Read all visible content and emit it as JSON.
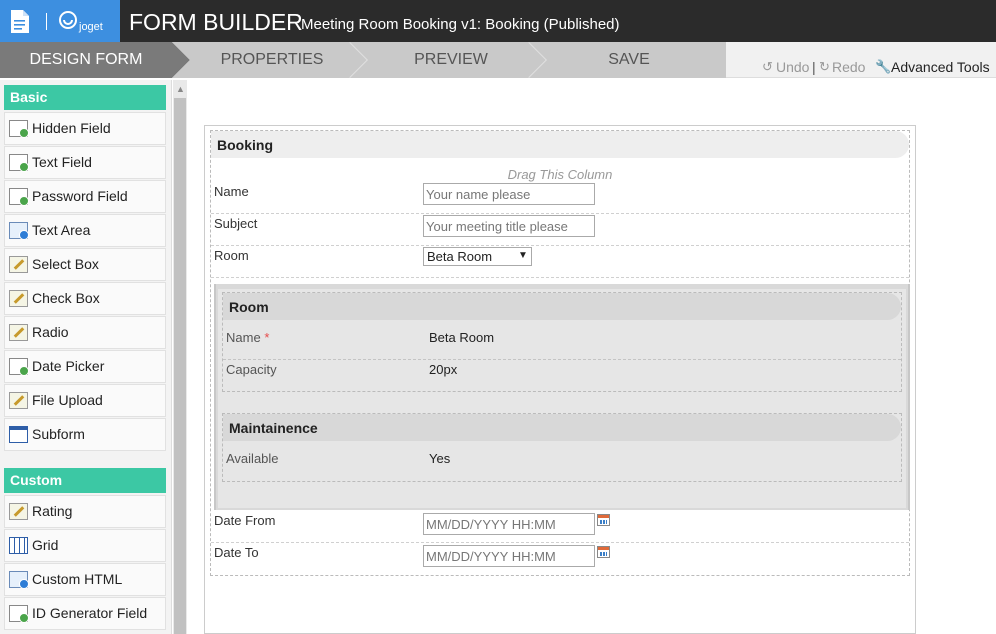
{
  "header": {
    "brand": "joget",
    "title": "FORM BUILDER",
    "subtitle": "Meeting Room Booking v1: Booking (Published)"
  },
  "steps": [
    "DESIGN FORM",
    "PROPERTIES",
    "PREVIEW",
    "SAVE"
  ],
  "active_step": "DESIGN FORM",
  "tools": {
    "undo": "Undo",
    "separator": "|",
    "redo": "Redo",
    "advanced": "Advanced Tools"
  },
  "palette": {
    "basic_title": "Basic",
    "basic": [
      {
        "label": "Hidden Field",
        "icon": "hidden-field-icon"
      },
      {
        "label": "Text Field",
        "icon": "text-field-icon"
      },
      {
        "label": "Password Field",
        "icon": "password-field-icon"
      },
      {
        "label": "Text Area",
        "icon": "text-area-icon"
      },
      {
        "label": "Select Box",
        "icon": "select-box-icon"
      },
      {
        "label": "Check Box",
        "icon": "check-box-icon"
      },
      {
        "label": "Radio",
        "icon": "radio-icon"
      },
      {
        "label": "Date Picker",
        "icon": "date-picker-icon"
      },
      {
        "label": "File Upload",
        "icon": "file-upload-icon"
      },
      {
        "label": "Subform",
        "icon": "subform-icon"
      }
    ],
    "custom_title": "Custom",
    "custom": [
      {
        "label": "Rating",
        "icon": "rating-icon"
      },
      {
        "label": "Grid",
        "icon": "grid-icon"
      },
      {
        "label": "Custom HTML",
        "icon": "custom-html-icon"
      },
      {
        "label": "ID Generator Field",
        "icon": "id-generator-icon"
      }
    ]
  },
  "form": {
    "section_title": "Booking",
    "drag_hint": "Drag This Column",
    "fields": {
      "name_label": "Name",
      "name_placeholder": "Your name please",
      "subject_label": "Subject",
      "subject_placeholder": "Your meeting title please",
      "room_label": "Room",
      "room_selected": "Beta Room",
      "date_from_label": "Date From",
      "date_from_placeholder": "MM/DD/YYYY HH:MM",
      "date_to_label": "Date To",
      "date_to_placeholder": "MM/DD/YYYY HH:MM"
    },
    "subform": {
      "room_section": "Room",
      "name_label": "Name",
      "required_mark": "*",
      "name_value": "Beta Room",
      "capacity_label": "Capacity",
      "capacity_value": "20px",
      "maint_section": "Maintainence",
      "available_label": "Available",
      "available_value": "Yes"
    }
  },
  "colors": {
    "topbar": "#2b2b2b",
    "logo_bg": "#3d8fe0",
    "active_step": "#7a7a7a",
    "palette_header": "#3cc8a4"
  }
}
